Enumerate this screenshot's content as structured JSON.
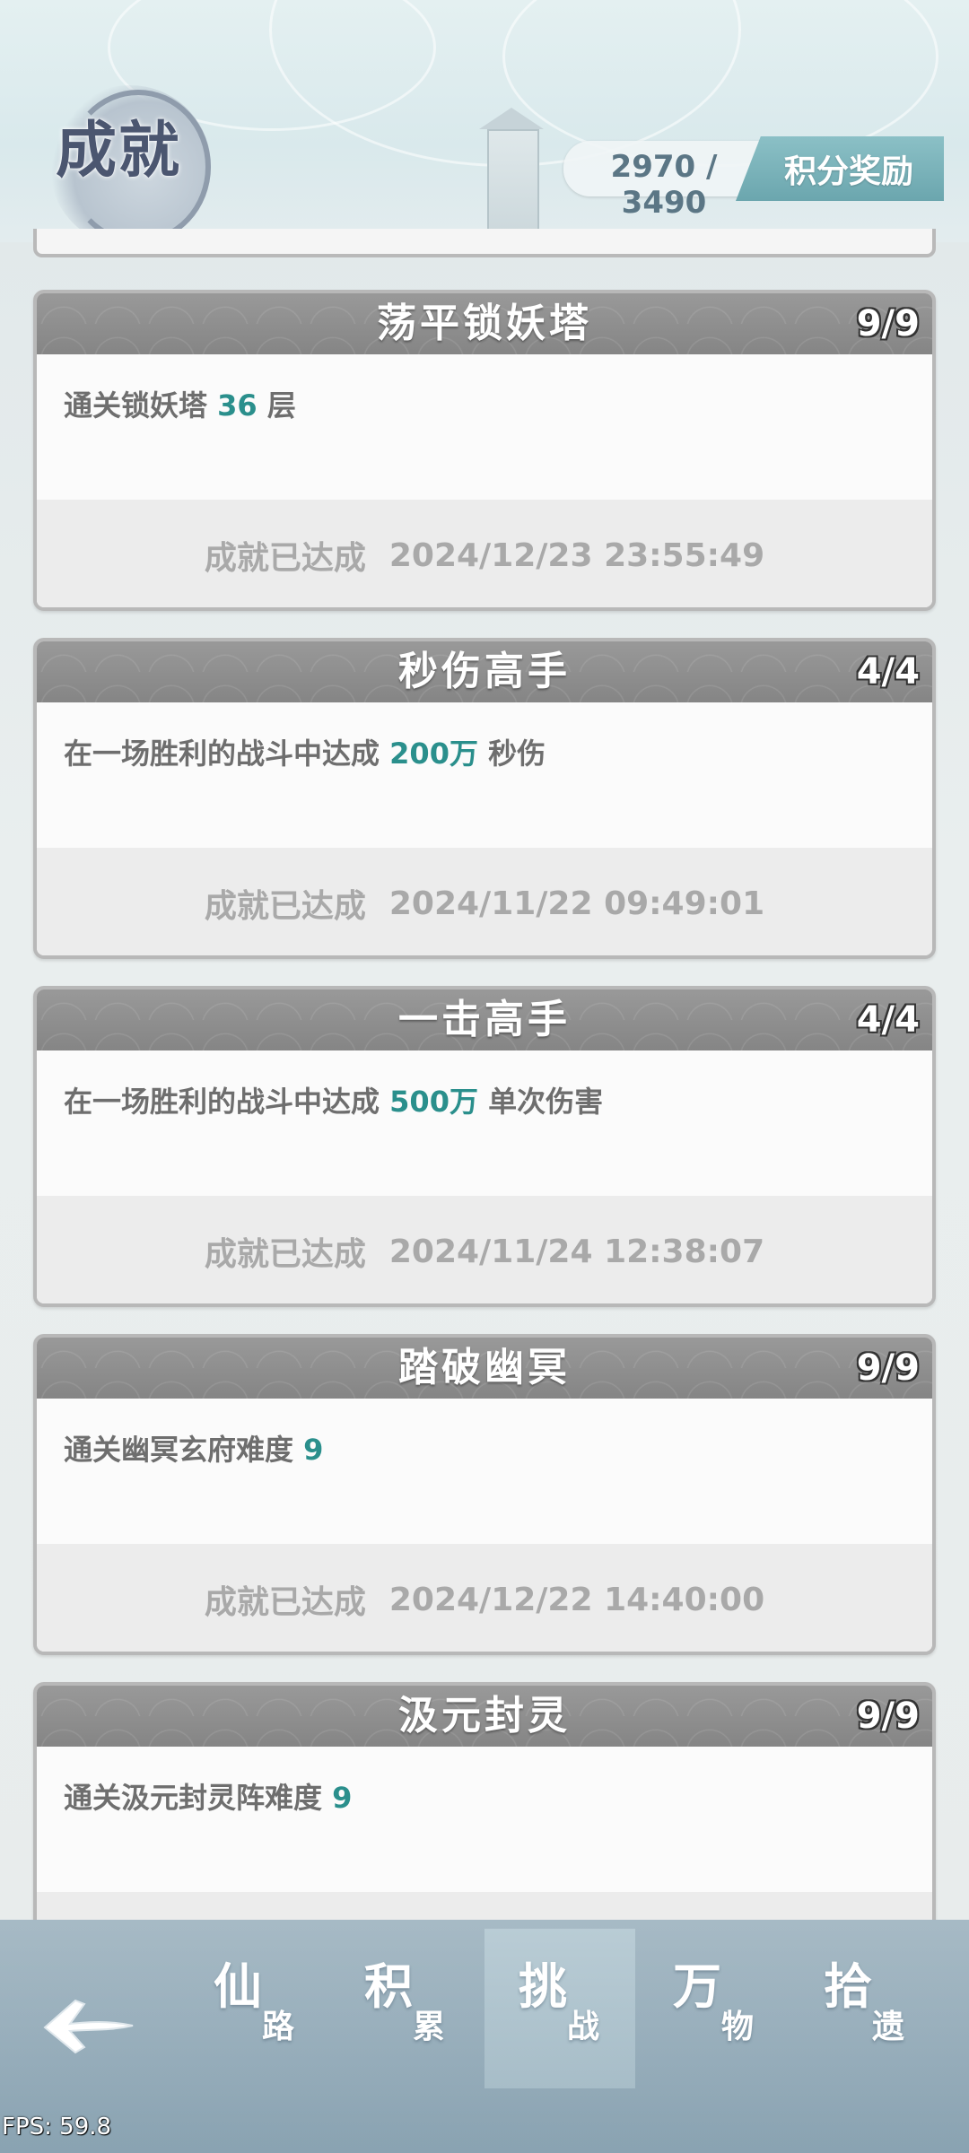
{
  "header": {
    "title": "成就",
    "score": "2970 / 3490",
    "reward_button": "积分奖励"
  },
  "achievements": [
    {
      "title": "荡平锁妖塔",
      "progress": "9/9",
      "desc_prefix": "通关锁妖塔 ",
      "desc_highlight": "36",
      "desc_suffix": " 层",
      "status": "成就已达成",
      "date": "2024/12/23 23:55:49"
    },
    {
      "title": "秒伤高手",
      "progress": "4/4",
      "desc_prefix": "在一场胜利的战斗中达成 ",
      "desc_highlight": "200万",
      "desc_suffix": " 秒伤",
      "status": "成就已达成",
      "date": "2024/11/22 09:49:01"
    },
    {
      "title": "一击高手",
      "progress": "4/4",
      "desc_prefix": "在一场胜利的战斗中达成 ",
      "desc_highlight": "500万",
      "desc_suffix": " 单次伤害",
      "status": "成就已达成",
      "date": "2024/11/24 12:38:07"
    },
    {
      "title": "踏破幽冥",
      "progress": "9/9",
      "desc_prefix": "通关幽冥玄府难度 ",
      "desc_highlight": "9",
      "desc_suffix": "",
      "status": "成就已达成",
      "date": "2024/12/22 14:40:00"
    },
    {
      "title": "汲元封灵",
      "progress": "9/9",
      "desc_prefix": "通关汲元封灵阵难度 ",
      "desc_highlight": "9",
      "desc_suffix": "",
      "status": "",
      "date": ""
    }
  ],
  "nav": {
    "tabs": [
      {
        "big": "仙",
        "small": "路"
      },
      {
        "big": "积",
        "small": "累"
      },
      {
        "big": "挑",
        "small": "战"
      },
      {
        "big": "万",
        "small": "物"
      },
      {
        "big": "拾",
        "small": "遗"
      }
    ],
    "active_index": 2
  },
  "fps": "FPS: 59.8",
  "colors": {
    "highlight": "#2a8f8c",
    "card_header": "#8f8f8f",
    "nav_bg": "#8fa8b6",
    "reward_button": "#7ab3ba"
  }
}
